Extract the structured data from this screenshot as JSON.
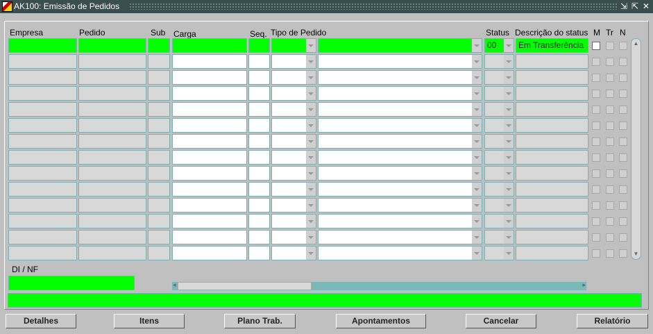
{
  "window": {
    "title": "AK100: Emissão de Pedidos"
  },
  "columns": {
    "empresa": "Empresa",
    "pedido": "Pedido",
    "sub": "Sub",
    "carga": "Carga",
    "seq": "Seq.",
    "tipo": "Tipo de Pedido",
    "status": "Status",
    "descricao": "Descrição do status",
    "m": "M",
    "tr": "Tr",
    "n": "N"
  },
  "rows": [
    {
      "status": "00",
      "descricao": "Em Transferência"
    },
    {},
    {},
    {},
    {},
    {},
    {},
    {},
    {},
    {},
    {},
    {},
    {},
    {}
  ],
  "dinf": {
    "label": "DI / NF",
    "value": ""
  },
  "buttons": [
    "Detalhes",
    "Itens",
    "Plano Trab.",
    "Apontamentos",
    "Cancelar",
    "Relatório"
  ],
  "colors": {
    "active": "#00ff00",
    "titlebar": "#3a4e4e"
  }
}
